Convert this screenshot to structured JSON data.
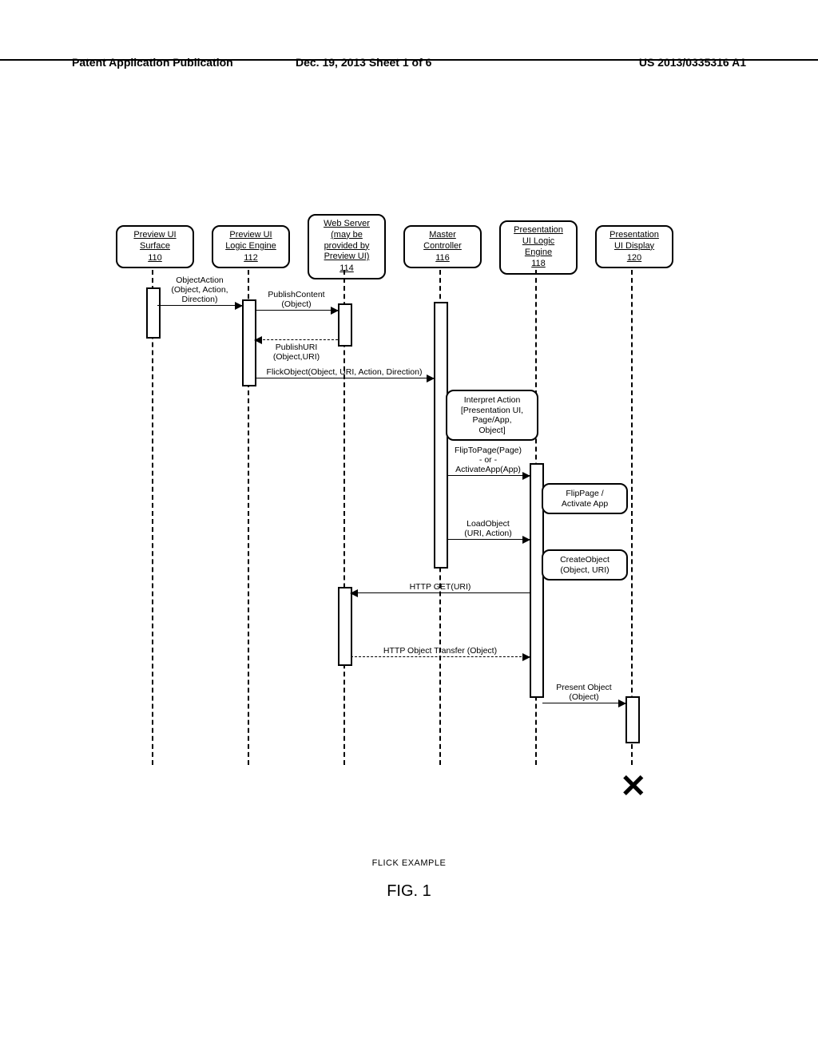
{
  "header": {
    "left": "Patent Application Publication",
    "center": "Dec. 19, 2013  Sheet 1 of 6",
    "right": "US 2013/0335316 A1"
  },
  "caption": {
    "title": "FLICK EXAMPLE",
    "figure": "FIG. 1"
  },
  "chart_data": {
    "type": "sequence_diagram",
    "lifelines": [
      {
        "name": "Preview UI Surface",
        "ref": "110"
      },
      {
        "name": "Preview UI Logic Engine",
        "ref": "112"
      },
      {
        "name": "Web Server (may be provided by Preview UI)",
        "ref": "114"
      },
      {
        "name": "Master Controller",
        "ref": "116"
      },
      {
        "name": "Presentation UI Logic Engine",
        "ref": "118"
      },
      {
        "name": "Presentation UI Display",
        "ref": "120"
      }
    ],
    "messages": [
      {
        "label": "ObjectAction (Object, Action, Direction)",
        "from": 0,
        "to": 1,
        "style": "solid"
      },
      {
        "label": "PublishContent (Object)",
        "from": 1,
        "to": 2,
        "style": "solid"
      },
      {
        "label": "PublishURI (Object,URI)",
        "from": 2,
        "to": 1,
        "style": "dashed"
      },
      {
        "label": "FlickObject(Object, URI, Action, Direction)",
        "from": 1,
        "to": 3,
        "style": "solid"
      },
      {
        "label": "FlipToPage(Page) - or - ActivateApp(App)",
        "from": 3,
        "to": 4,
        "style": "solid"
      },
      {
        "label": "LoadObject (URI, Action)",
        "from": 3,
        "to": 4,
        "style": "solid"
      },
      {
        "label": "HTTP GET(URI)",
        "from": 4,
        "to": 2,
        "style": "solid"
      },
      {
        "label": "HTTP Object Transfer (Object)",
        "from": 2,
        "to": 4,
        "style": "dashed"
      },
      {
        "label": "Present Object (Object)",
        "from": 4,
        "to": 5,
        "style": "solid"
      }
    ],
    "self_processes": [
      {
        "on": 3,
        "label": "Interpret Action [Presentation UI, Page/App, Object]"
      },
      {
        "on": 4,
        "label": "FlipPage / Activate App"
      },
      {
        "on": 4,
        "label": "CreateObject (Object, URI)"
      }
    ],
    "terminates": [
      5
    ]
  },
  "lifeline_labels": {
    "l0_line1": "Preview UI",
    "l0_line2": "Surface",
    "l0_ref": "110",
    "l1_line1": "Preview UI",
    "l1_line2": "Logic Engine",
    "l1_ref": "112",
    "l2_line1": "Web Server",
    "l2_line2": "(may be",
    "l2_line3": "provided by",
    "l2_line4": "Preview UI)",
    "l2_ref": "114",
    "l3_line1": "Master",
    "l3_line2": "Controller",
    "l3_ref": "116",
    "l4_line1": "Presentation",
    "l4_line2": "UI Logic",
    "l4_line3": "Engine",
    "l4_ref": "118",
    "l5_line1": "Presentation",
    "l5_line2": "UI Display",
    "l5_ref": "120"
  },
  "msg": {
    "m0_l1": "ObjectAction",
    "m0_l2": "(Object, Action,",
    "m0_l3": "Direction)",
    "m1_l1": "PublishContent",
    "m1_l2": "(Object)",
    "m2_l1": "PublishURI",
    "m2_l2": "(Object,URI)",
    "m3": "FlickObject(Object, URI, Action, Direction)",
    "proc0_l1": "Interpret Action",
    "proc0_l2": "[Presentation UI,",
    "proc0_l3": "Page/App,",
    "proc0_l4": "Object]",
    "m4_l1": "FlipToPage(Page)",
    "m4_l2": "- or -",
    "m4_l3": "ActivateApp(App)",
    "proc1_l1": "FlipPage /",
    "proc1_l2": "Activate App",
    "m5_l1": "LoadObject",
    "m5_l2": "(URI, Action)",
    "proc2_l1": "CreateObject",
    "proc2_l2": "(Object, URI)",
    "m6": "HTTP GET(URI)",
    "m7": "HTTP Object Transfer (Object)",
    "m8_l1": "Present Object",
    "m8_l2": "(Object)"
  }
}
